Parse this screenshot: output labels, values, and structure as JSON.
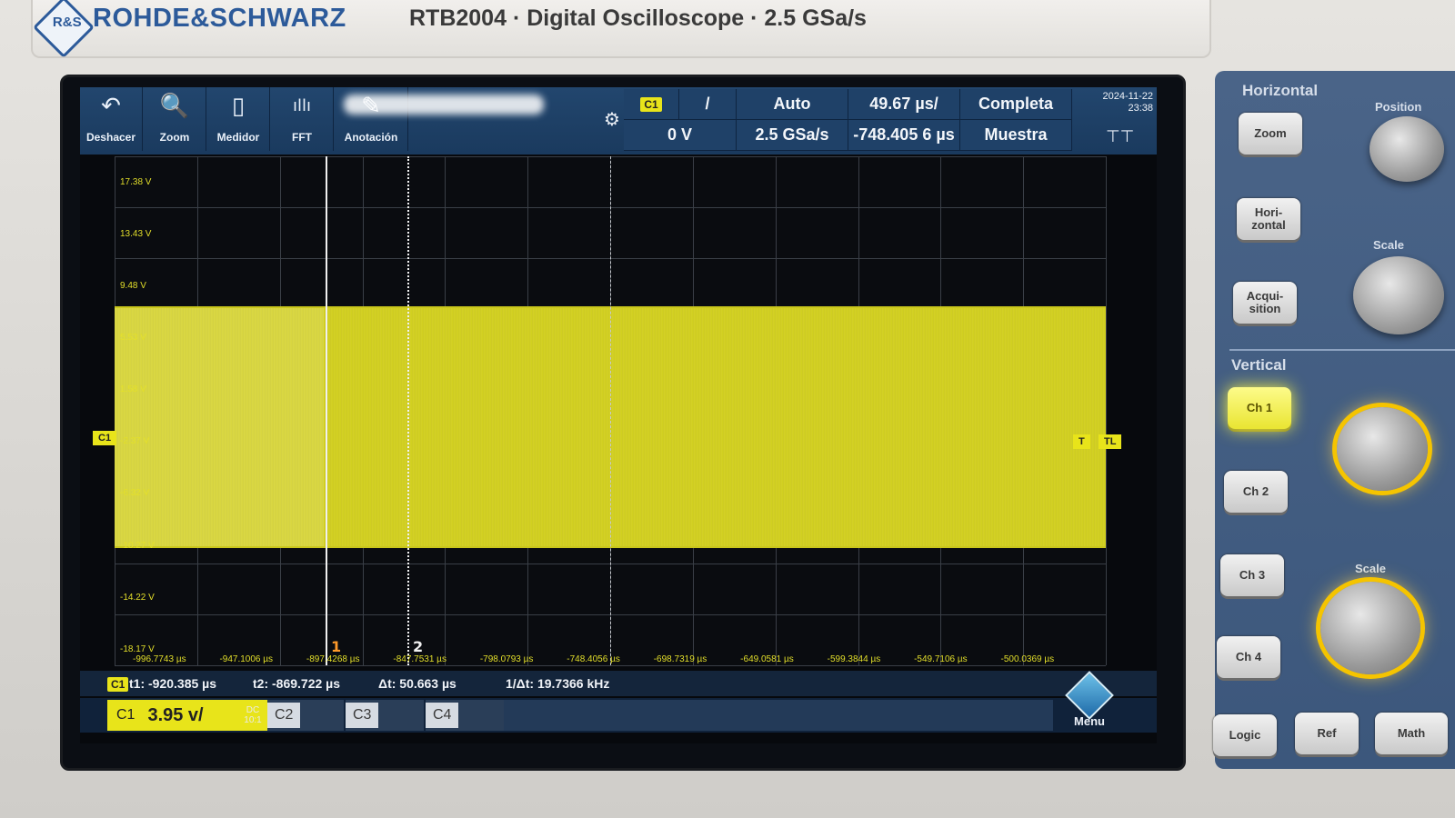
{
  "brand": {
    "logo_text": "R&S",
    "name": "ROHDE&SCHWARZ",
    "model": "RTB2004 · Digital Oscilloscope · 2.5 GSa/s"
  },
  "toolbar": {
    "tools": [
      {
        "label": "Deshacer",
        "icon": "undo-icon",
        "glyph": "↶"
      },
      {
        "label": "Zoom",
        "icon": "zoom-icon",
        "glyph": "🔍"
      },
      {
        "label": "Medidor",
        "icon": "meter-icon",
        "glyph": "▯"
      },
      {
        "label": "FFT",
        "icon": "fft-icon",
        "glyph": "ıllı"
      },
      {
        "label": "Anotación",
        "icon": "annotation-icon",
        "glyph": "✎"
      }
    ],
    "trigger_source": "C1",
    "trigger_slope": "/",
    "trigger_level": "0 V",
    "trigger_mode": "Auto",
    "sample_rate": "2.5 GSa/s",
    "time_scale": "49.67 µs/",
    "time_position": "-748.405 6 µs",
    "record": "Completa",
    "acq_mode": "Muestra",
    "date": "2024-11-22",
    "time": "23:38"
  },
  "waveform": {
    "channel_marker": "C1",
    "trigger_marker_left": "T",
    "trigger_marker_right": "TL",
    "volt_labels": [
      "17.38 V",
      "13.43 V",
      "9.48 V",
      "5.53 V",
      "1.58 V",
      "-2.37 V",
      "-6.32 V",
      "-10.27 V",
      "-14.22 V",
      "-18.17 V"
    ],
    "time_labels": [
      "-996.7743 µs",
      "-947.1006 µs",
      "-897.4268 µs",
      "-847.7531 µs",
      "-798.0793 µs",
      "-748.4056 µs",
      "-698.7319 µs",
      "-649.0581 µs",
      "-599.3844 µs",
      "-549.7106 µs",
      "-500.0369 µs"
    ],
    "cursor1_label": "1",
    "cursor2_label": "2",
    "signal_top_v": 7.8,
    "signal_bottom_v": -10.3
  },
  "measurement": {
    "chip": "C1",
    "t1": "t1: -920.385 µs",
    "t2": "t2: -869.722 µs",
    "dt": "Δt: 50.663 µs",
    "inv_dt": "1/Δt: 19.7366 kHz"
  },
  "channels": {
    "c1_label": "C1",
    "c1_scale": "3.95 v/",
    "c1_coupling": "DC",
    "c1_probe": "10:1",
    "c2_label": "C2",
    "c3_label": "C3",
    "c4_label": "C4",
    "menu_label": "Menu"
  },
  "panel": {
    "horizontal_title": "Horizontal",
    "position_label": "Position",
    "scale_label": "Scale",
    "zoom_btn": "Zoom",
    "horizontal_btn": "Hori-\nzontal",
    "acquisition_btn": "Acqui-\nsition",
    "vertical_title": "Vertical",
    "ch1_btn": "Ch 1",
    "ch2_btn": "Ch 2",
    "ch3_btn": "Ch 3",
    "ch4_btn": "Ch 4",
    "vscale_label": "Scale",
    "logic_btn": "Logic",
    "ref_btn": "Ref",
    "math_btn": "Math"
  },
  "colors": {
    "trace": "#d8d51f",
    "toolbar": "#1f4168",
    "panel": "#4a6488",
    "brand": "#2c5a9a"
  }
}
